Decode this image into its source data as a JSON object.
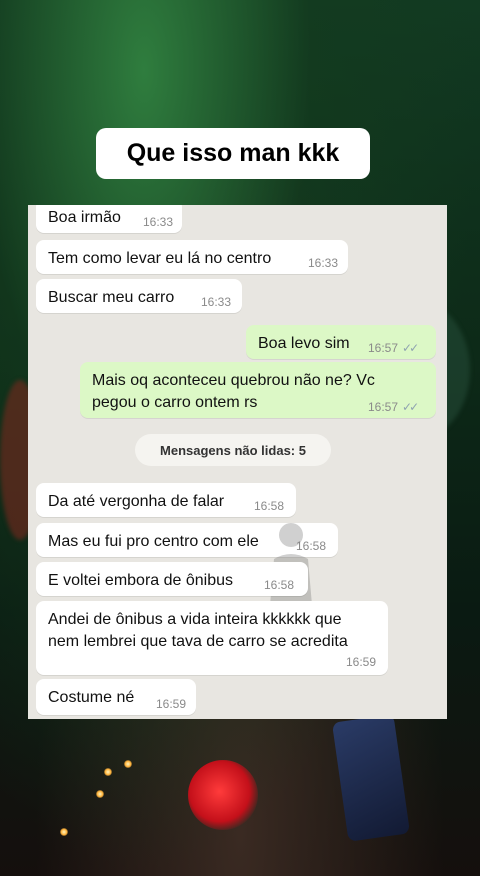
{
  "caption": "Que isso man kkk",
  "divider": "Mensagens não lidas: 5",
  "messages": [
    {
      "text": "Boa irmão",
      "time": "16:33"
    },
    {
      "text": "Tem como levar eu lá no centro",
      "time": "16:33"
    },
    {
      "text": "Buscar meu carro",
      "time": "16:33"
    },
    {
      "text": "Boa levo sim",
      "time": "16:57",
      "ticks": "✓✓"
    },
    {
      "text": "Mais oq aconteceu quebrou não ne? Vc\npegou o carro ontem rs",
      "time": "16:57",
      "ticks": "✓✓"
    },
    {
      "text": "Da até vergonha de falar",
      "time": "16:58"
    },
    {
      "text": "Mas eu fui pro centro com ele",
      "time": "16:58"
    },
    {
      "text": "E voltei embora de ônibus",
      "time": "16:58"
    },
    {
      "text": "Andei de ônibus a vida inteira kkkkkk que\nnem lembrei que tava de carro se acredita",
      "time": "16:59"
    },
    {
      "text": "Costume né",
      "time": "16:59"
    }
  ],
  "colors": {
    "incoming": "#ffffff",
    "outgoing": "#dcf8c6",
    "chat_bg": "#e8e6e1",
    "tick": "#8fa3b0"
  }
}
